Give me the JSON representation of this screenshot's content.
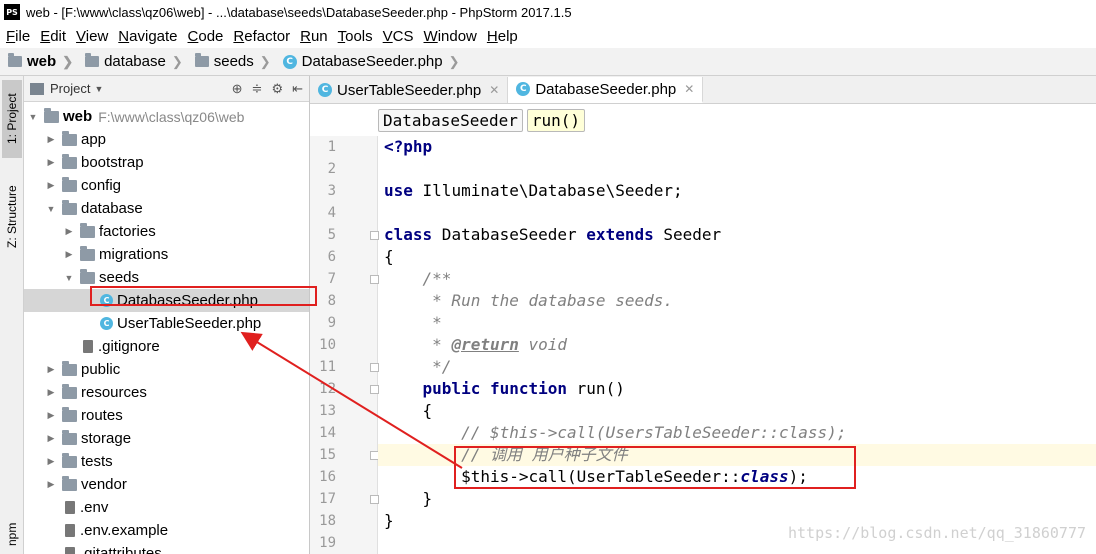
{
  "window": {
    "app_icon_text": "PS",
    "title": "web - [F:\\www\\class\\qz06\\web] - ...\\database\\seeds\\DatabaseSeeder.php - PhpStorm 2017.1.5"
  },
  "menu": [
    "File",
    "Edit",
    "View",
    "Navigate",
    "Code",
    "Refactor",
    "Run",
    "Tools",
    "VCS",
    "Window",
    "Help"
  ],
  "navbar": {
    "crumbs": [
      "web",
      "database",
      "seeds",
      "DatabaseSeeder.php"
    ]
  },
  "toolstrip": {
    "project_tab": "1: Project",
    "structure_tab": "Z: Structure",
    "npm_tab": "npm"
  },
  "project_panel": {
    "header": "Project",
    "root_name": "web",
    "root_path": "F:\\www\\class\\qz06\\web",
    "items": [
      {
        "name": "app",
        "kind": "folder",
        "depth": 1,
        "expanded": false
      },
      {
        "name": "bootstrap",
        "kind": "folder",
        "depth": 1,
        "expanded": false
      },
      {
        "name": "config",
        "kind": "folder",
        "depth": 1,
        "expanded": false
      },
      {
        "name": "database",
        "kind": "folder",
        "depth": 1,
        "expanded": true
      },
      {
        "name": "factories",
        "kind": "folder",
        "depth": 2,
        "expanded": false
      },
      {
        "name": "migrations",
        "kind": "folder",
        "depth": 2,
        "expanded": false
      },
      {
        "name": "seeds",
        "kind": "folder",
        "depth": 2,
        "expanded": true
      },
      {
        "name": "DatabaseSeeder.php",
        "kind": "php",
        "depth": 3,
        "selected": true
      },
      {
        "name": "UserTableSeeder.php",
        "kind": "php",
        "depth": 3
      },
      {
        "name": ".gitignore",
        "kind": "file",
        "depth": 2
      },
      {
        "name": "public",
        "kind": "folder",
        "depth": 1,
        "expanded": false
      },
      {
        "name": "resources",
        "kind": "folder",
        "depth": 1,
        "expanded": false
      },
      {
        "name": "routes",
        "kind": "folder",
        "depth": 1,
        "expanded": false
      },
      {
        "name": "storage",
        "kind": "folder",
        "depth": 1,
        "expanded": false
      },
      {
        "name": "tests",
        "kind": "folder",
        "depth": 1,
        "expanded": false
      },
      {
        "name": "vendor",
        "kind": "folder",
        "depth": 1,
        "expanded": false
      },
      {
        "name": ".env",
        "kind": "file",
        "depth": 1
      },
      {
        "name": ".env.example",
        "kind": "file",
        "depth": 1
      },
      {
        "name": ".gitattributes",
        "kind": "file",
        "depth": 1
      }
    ]
  },
  "editor": {
    "tabs": [
      {
        "label": "UserTableSeeder.php",
        "active": false
      },
      {
        "label": "DatabaseSeeder.php",
        "active": true
      }
    ],
    "breadcrumbs": [
      "DatabaseSeeder",
      "run()"
    ],
    "current_line": 15,
    "lines": [
      {
        "n": "1",
        "html": "<span class='kw'>&lt;?php</span>"
      },
      {
        "n": "2",
        "html": ""
      },
      {
        "n": "3",
        "html": "<span class='kw'>use</span> Illuminate\\Database\\Seeder;"
      },
      {
        "n": "4",
        "html": ""
      },
      {
        "n": "5",
        "html": "<span class='kw'>class</span> DatabaseSeeder <span class='kw'>extends</span> Seeder"
      },
      {
        "n": "6",
        "html": "{"
      },
      {
        "n": "7",
        "html": "    <span class='doc'>/**</span>"
      },
      {
        "n": "8",
        "html": "<span class='doc'>     * Run the database seeds.</span>"
      },
      {
        "n": "9",
        "html": "<span class='doc'>     *</span>"
      },
      {
        "n": "10",
        "html": "<span class='doc'>     * </span><span class='doctag'>@return</span><span class='doc'> void</span>"
      },
      {
        "n": "11",
        "html": "<span class='doc'>     */</span>"
      },
      {
        "n": "12",
        "html": "    <span class='kw'>public function</span> run()"
      },
      {
        "n": "13",
        "html": "    {"
      },
      {
        "n": "14",
        "html": "        <span class='cm'>// $this-&gt;call(UsersTableSeeder::class);</span>"
      },
      {
        "n": "15",
        "html": "        <span class='cm'>// 调用 用户种子文件</span>"
      },
      {
        "n": "16",
        "html": "        $this-&gt;call(UserTableSeeder::<span class='cls-kw'>class</span>);"
      },
      {
        "n": "17",
        "html": "    }"
      },
      {
        "n": "18",
        "html": "}"
      },
      {
        "n": "19",
        "html": ""
      }
    ],
    "fold_lines": [
      5,
      7,
      11,
      12,
      15,
      17
    ]
  },
  "watermark": "https://blog.csdn.net/qq_31860777",
  "colors": {
    "annotation": "#e0201f",
    "keyword": "#000080",
    "comment": "#808080",
    "current_line": "#fffae3"
  }
}
